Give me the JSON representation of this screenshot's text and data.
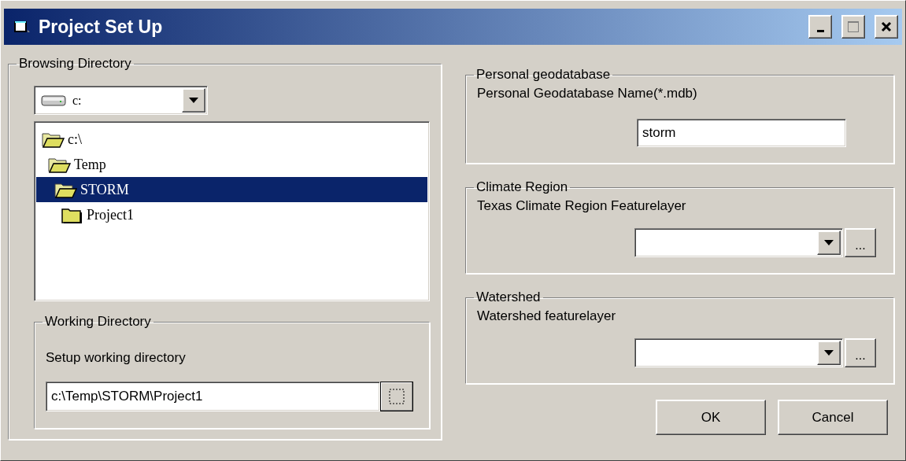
{
  "window": {
    "title": "Project Set Up",
    "controls": [
      {
        "kind": "minimize",
        "disabled": false
      },
      {
        "kind": "maximize",
        "disabled": true
      },
      {
        "kind": "close",
        "disabled": false
      }
    ]
  },
  "browsing_directory": {
    "title": "Browsing Directory",
    "drive": "c:",
    "tree": [
      {
        "label": "c:\\",
        "expanded": true,
        "selected": false,
        "children": [
          {
            "label": "Temp",
            "expanded": true,
            "selected": false,
            "children": [
              {
                "label": "STORM",
                "expanded": true,
                "selected": true,
                "children": [
                  {
                    "label": "Project1",
                    "expanded": false,
                    "selected": false
                  }
                ]
              }
            ]
          }
        ]
      }
    ],
    "working_directory": {
      "title": "Working Directory",
      "label": "Setup working directory",
      "value": "c:\\Temp\\STORM\\Project1"
    }
  },
  "personal_geodatabase": {
    "title": "Personal geodatabase",
    "label": "Personal Geodatabase Name(*.mdb)",
    "value": "storm"
  },
  "climate_region": {
    "title": "Climate Region",
    "label": "Texas Climate Region Featurelayer",
    "browse_button": "..."
  },
  "watershed": {
    "title": "Watershed",
    "label": "Watershed featurelayer",
    "browse_button": "..."
  },
  "buttons": [
    "OK",
    "Cancel"
  ]
}
